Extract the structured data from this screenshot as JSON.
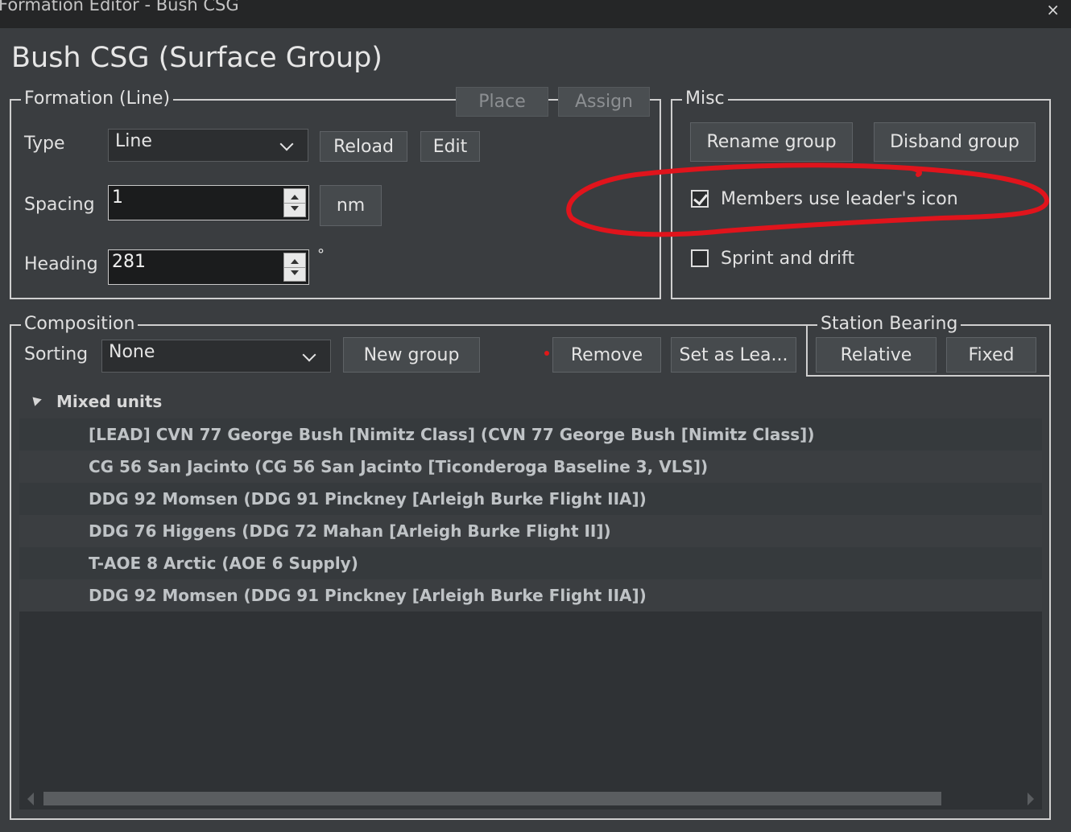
{
  "window": {
    "titlebar_text": "Formation Editor - Bush CSG",
    "close_glyph": "×",
    "heading": "Bush CSG (Surface Group)"
  },
  "formation": {
    "legend": "Formation (Line)",
    "place_label": "Place",
    "assign_label": "Assign",
    "type_label": "Type",
    "type_value": "Line",
    "reload_label": "Reload",
    "edit_label": "Edit",
    "spacing_label": "Spacing",
    "spacing_value": "1",
    "spacing_unit": "nm",
    "heading_label": "Heading",
    "heading_value": "281",
    "heading_unit": "°"
  },
  "misc": {
    "legend": "Misc",
    "rename_label": "Rename group",
    "disband_label": "Disband group",
    "members_icon_label": "Members use leader's icon",
    "members_icon_checked": true,
    "sprint_label": "Sprint and drift",
    "sprint_checked": false
  },
  "composition": {
    "legend": "Composition",
    "sorting_label": "Sorting",
    "sorting_value": "None",
    "new_group_label": "New group",
    "remove_label": "Remove",
    "set_leader_label": "Set as Lea..."
  },
  "station_bearing": {
    "legend": "Station Bearing",
    "relative_label": "Relative",
    "fixed_label": "Fixed"
  },
  "units": {
    "group_name": "Mixed units",
    "rows": [
      "[LEAD] CVN 77 George Bush [Nimitz Class]  (CVN 77 George Bush [Nimitz Class])",
      "CG 56 San Jacinto (CG 56 San Jacinto [Ticonderoga Baseline 3, VLS])",
      "DDG 92 Momsen (DDG 91 Pinckney [Arleigh Burke Flight IIA])",
      "DDG 76 Higgens (DDG 72 Mahan [Arleigh Burke Flight II])",
      "T-AOE 8 Arctic (AOE 6 Supply)",
      "DDG 92 Momsen (DDG 91 Pinckney [Arleigh Burke Flight IIA])"
    ]
  },
  "colors": {
    "annotation": "#e0141c",
    "background": "#3a3d40",
    "titlebar": "#252627"
  }
}
